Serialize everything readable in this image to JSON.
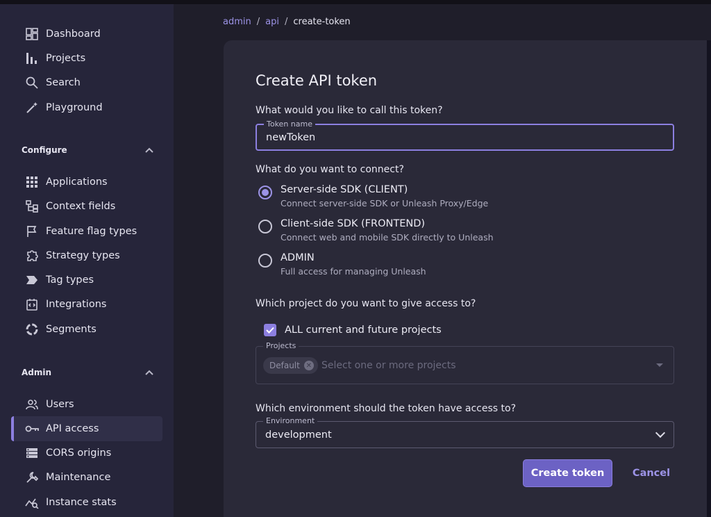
{
  "sidebar": {
    "items": [
      {
        "label": "Dashboard",
        "icon": "dashboard-icon"
      },
      {
        "label": "Projects",
        "icon": "projects-icon"
      },
      {
        "label": "Search",
        "icon": "search-icon"
      },
      {
        "label": "Playground",
        "icon": "playground-icon"
      }
    ],
    "configure": {
      "title": "Configure",
      "items": [
        {
          "label": "Applications",
          "icon": "applications-icon"
        },
        {
          "label": "Context fields",
          "icon": "context-fields-icon"
        },
        {
          "label": "Feature flag types",
          "icon": "flag-icon"
        },
        {
          "label": "Strategy types",
          "icon": "strategy-icon"
        },
        {
          "label": "Tag types",
          "icon": "tag-icon"
        },
        {
          "label": "Integrations",
          "icon": "integrations-icon"
        },
        {
          "label": "Segments",
          "icon": "segments-icon"
        }
      ]
    },
    "admin": {
      "title": "Admin",
      "items": [
        {
          "label": "Users",
          "icon": "users-icon"
        },
        {
          "label": "API access",
          "icon": "key-icon",
          "active": true
        },
        {
          "label": "CORS origins",
          "icon": "cors-icon"
        },
        {
          "label": "Maintenance",
          "icon": "wrench-icon"
        },
        {
          "label": "Instance stats",
          "icon": "stats-icon"
        }
      ]
    }
  },
  "breadcrumb": {
    "items": [
      "admin",
      "api",
      "create-token"
    ],
    "separator": "/"
  },
  "form": {
    "title": "Create API token",
    "name_question": "What would you like to call this token?",
    "name_label": "Token name",
    "name_value": "newToken",
    "connect_question": "What do you want to connect?",
    "options": [
      {
        "title": "Server-side SDK (CLIENT)",
        "desc": "Connect server-side SDK or Unleash Proxy/Edge",
        "checked": true
      },
      {
        "title": "Client-side SDK (FRONTEND)",
        "desc": "Connect web and mobile SDK directly to Unleash",
        "checked": false
      },
      {
        "title": "ADMIN",
        "desc": "Full access for managing Unleash",
        "checked": false
      }
    ],
    "project_question": "Which project do you want to give access to?",
    "all_projects_label": "ALL current and future projects",
    "all_projects_checked": true,
    "projects_label": "Projects",
    "projects_chip": "Default",
    "projects_placeholder": "Select one or more projects",
    "env_question": "Which environment should the token have access to?",
    "env_label": "Environment",
    "env_value": "development",
    "create_label": "Create token",
    "cancel_label": "Cancel"
  },
  "colors": {
    "accent": "#8c7fe0",
    "primary_button": "#6c62c4",
    "background": "#1f1e2a",
    "card": "#2a2938",
    "sidebar": "#26253a"
  }
}
